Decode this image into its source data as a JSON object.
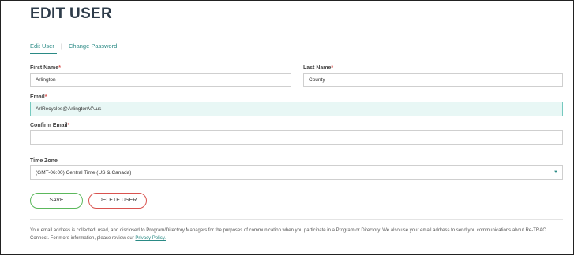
{
  "page": {
    "title": "EDIT USER"
  },
  "tabs": [
    {
      "label": "Edit User",
      "active": true
    },
    {
      "label": "Change Password",
      "active": false
    }
  ],
  "tab_separator": "|",
  "form": {
    "first_name": {
      "label": "First Name",
      "required_mark": "*",
      "value": "Arlington"
    },
    "last_name": {
      "label": "Last Name",
      "required_mark": "*",
      "value": "County"
    },
    "email": {
      "label": "Email",
      "required_mark": "*",
      "value": "ArlRecycles@ArlingtonVA.us"
    },
    "confirm_email": {
      "label": "Confirm Email",
      "required_mark": "*",
      "value": ""
    },
    "time_zone": {
      "label": "Time Zone",
      "selected": "(GMT-06:00) Central Time (US & Canada)"
    }
  },
  "buttons": {
    "save": "SAVE",
    "delete_user": "DELETE USER"
  },
  "footer": {
    "text": "Your email address is collected, used, and disclosed to Program/Directory Managers for the purposes of communication when you participate in a Program or Directory. We also use your email address to send you communications about Re-TRAC Connect. For more information, please review our ",
    "privacy_link": "Privacy Policy."
  },
  "colors": {
    "accent": "#2a8a85",
    "required": "#d9534f",
    "save_border": "#5cb85c",
    "delete_border": "#d9534f",
    "focused_field_bg": "#e8f7f5"
  },
  "icons": {
    "select_caret": "chevron-down-icon"
  }
}
